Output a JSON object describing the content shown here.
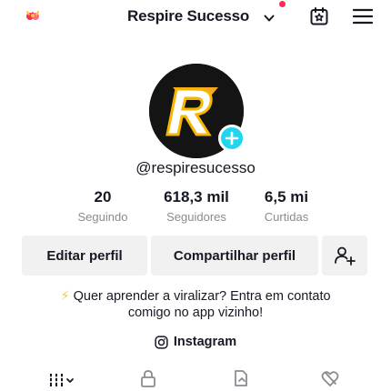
{
  "header": {
    "account_name": "Respire Sucesso",
    "left_icon": "creator-tools-icon",
    "calendar_icon": "calendar-star-icon",
    "menu_icon": "hamburger-menu-icon",
    "notification_dot_color": "#fe2c55"
  },
  "profile": {
    "username": "@respiresucesso",
    "avatar_icon": "brand-logo-avatar",
    "add_badge_color": "#20d5ec"
  },
  "stats": [
    {
      "value": "20",
      "label": "Seguindo"
    },
    {
      "value": "618,3 mil",
      "label": "Seguidores"
    },
    {
      "value": "6,5 mi",
      "label": "Curtidas"
    }
  ],
  "buttons": {
    "edit_profile": "Editar perfil",
    "share_profile": "Compartilhar perfil",
    "add_friends_icon": "add-friend-icon"
  },
  "bio": {
    "emoji": "⚡",
    "line1": " Quer aprender a viralizar? Entra em contato",
    "line2": "comigo no app vizinho!"
  },
  "link": {
    "icon": "instagram-icon",
    "label": "Instagram"
  },
  "tabs": [
    {
      "icon": "videos-grid-icon",
      "active": true
    },
    {
      "icon": "private-lock-icon",
      "active": false
    },
    {
      "icon": "reposts-icon",
      "active": false
    },
    {
      "icon": "liked-heart-icon",
      "active": false
    }
  ]
}
